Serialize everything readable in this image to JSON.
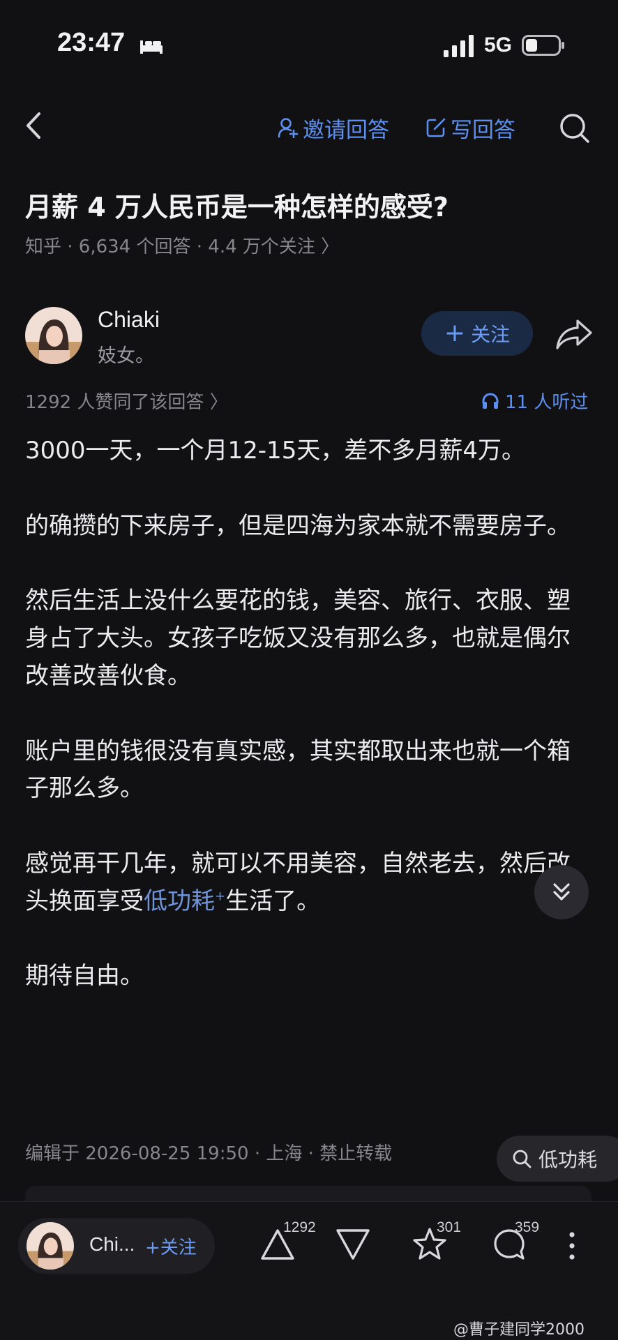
{
  "status_bar": {
    "time": "23:47",
    "network": "5G"
  },
  "nav": {
    "invite_label": "邀请回答",
    "write_label": "写回答"
  },
  "question": {
    "title": "月薪 4 万人民币是一种怎样的感受?",
    "meta": "知乎 · 6,634 个回答 · 4.4 万个关注 〉"
  },
  "author": {
    "name": "Chiaki",
    "bio": "妓女。",
    "follow_label": "关注"
  },
  "answer_stats": {
    "agree_text": "1292 人赞同了该回答 〉",
    "listen_text": "11 人听过"
  },
  "answer": {
    "p1": "3000一天，一个月12-15天，差不多月薪4万。",
    "p2": "的确攒的下来房子，但是四海为家本就不需要房子。",
    "p3": "然后生活上没什么要花的钱，美容、旅行、衣服、塑身占了大头。女孩子吃饭又没有那么多，也就是偶尔改善改善伙食。",
    "p4": "账户里的钱很没有真实感，其实都取出来也就一个箱子那么多。",
    "p5_before": "感觉再干几年，就可以不用美容，自然老去，然后改头换面享受",
    "p5_keyword": "低功耗",
    "p5_after": "生活了。",
    "p6": "期待自由。"
  },
  "footer_meta": "编辑于 2026-08-25 19:50 · 上海 · 禁止转载",
  "keyword_chip": "低功耗",
  "bottom_bar": {
    "author_short": "Chi...",
    "follow_label": "+关注",
    "upvotes": "1292",
    "favorites": "301",
    "comments": "359"
  },
  "watermark": "@曹子建同学2000",
  "colors": {
    "accent": "#5b8ff0",
    "background": "#111114"
  }
}
